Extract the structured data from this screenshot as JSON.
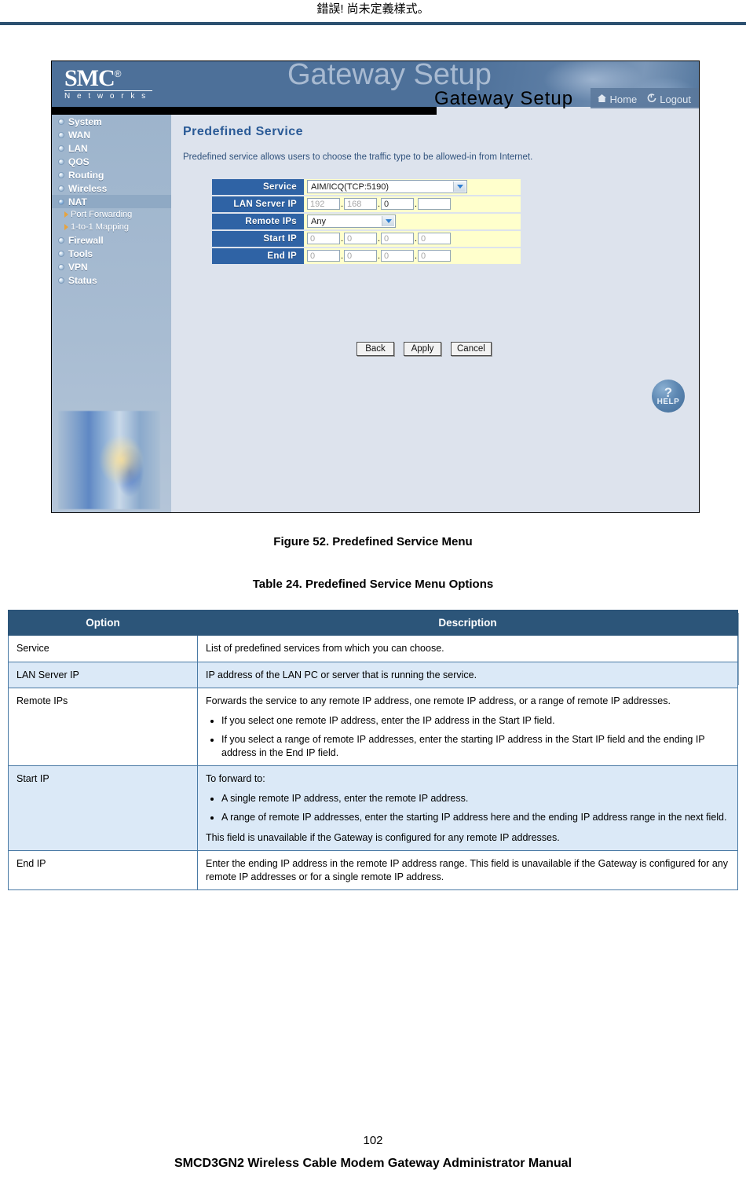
{
  "document": {
    "header_note": "錯誤! 尚未定義樣式。",
    "figure_caption": "Figure 52. Predefined Service Menu",
    "table_caption": "Table 24. Predefined Service Menu Options",
    "footer_page_number": "102",
    "footer_title": "SMCD3GN2 Wireless Cable Modem Gateway Administrator Manual"
  },
  "router_ui": {
    "logo": {
      "brand": "SMC",
      "registered_mark": "®",
      "tagline": "N e t w o r k s"
    },
    "banner": {
      "watermark": "Gateway Setup",
      "title": "Gateway Setup",
      "home_label": "Home",
      "logout_label": "Logout"
    },
    "sidebar": {
      "items": [
        {
          "label": "System",
          "active": false
        },
        {
          "label": "WAN",
          "active": false
        },
        {
          "label": "LAN",
          "active": false
        },
        {
          "label": "QOS",
          "active": false
        },
        {
          "label": "Routing",
          "active": false
        },
        {
          "label": "Wireless",
          "active": false
        },
        {
          "label": "NAT",
          "active": true
        },
        {
          "label": "Firewall",
          "active": false
        },
        {
          "label": "Tools",
          "active": false
        },
        {
          "label": "VPN",
          "active": false
        },
        {
          "label": "Status",
          "active": false
        }
      ],
      "submenu": [
        {
          "label": "Port Forwarding"
        },
        {
          "label": "1-to-1 Mapping"
        }
      ]
    },
    "page": {
      "title": "Predefined Service",
      "description": "Predefined service allows users to choose the traffic type to be allowed-in from Internet.",
      "fields": {
        "service": {
          "label": "Service",
          "value": "AIM/ICQ(TCP:5190)"
        },
        "lan_server_ip": {
          "label": "LAN Server IP",
          "octets": [
            "192",
            "168",
            "0",
            ""
          ]
        },
        "remote_ips": {
          "label": "Remote IPs",
          "value": "Any"
        },
        "start_ip": {
          "label": "Start IP",
          "octets": [
            "0",
            "0",
            "0",
            "0"
          ]
        },
        "end_ip": {
          "label": "End IP",
          "octets": [
            "0",
            "0",
            "0",
            "0"
          ]
        }
      },
      "buttons": {
        "back": "Back",
        "apply": "Apply",
        "cancel": "Cancel"
      },
      "help": {
        "mark": "?",
        "label": "HELP"
      }
    }
  },
  "options_table": {
    "headers": {
      "option": "Option",
      "description": "Description"
    },
    "rows": [
      {
        "option": "Service",
        "intro": "List of predefined services from which you can choose.",
        "bullets": [],
        "outro": ""
      },
      {
        "option": "LAN Server IP",
        "intro": "IP address of the LAN PC or server that is running the service.",
        "bullets": [],
        "outro": ""
      },
      {
        "option": "Remote IPs",
        "intro": "Forwards the service to any remote IP address, one remote IP address, or a range of remote IP addresses.",
        "bullets": [
          "If you select one remote IP address, enter the IP address in the Start IP field.",
          "If you select a range of remote IP addresses, enter the starting IP address in the Start IP field and the ending IP address in the End IP field."
        ],
        "outro": ""
      },
      {
        "option": "Start IP",
        "intro": "To forward to:",
        "bullets": [
          "A single remote IP address, enter the remote IP address.",
          "A range of remote IP addresses, enter the starting IP address here and the ending IP address range in the next field."
        ],
        "outro": "This field is unavailable if the Gateway is configured for any remote IP addresses."
      },
      {
        "option": "End IP",
        "intro": "Enter the ending IP address in the remote IP address range. This field is unavailable if the Gateway is configured for any remote IP addresses or for a single remote IP address.",
        "bullets": [],
        "outro": ""
      }
    ]
  },
  "colors": {
    "rule": "#2c5070",
    "banner_blue": "#4d7099",
    "label_blue": "#2f63a5",
    "field_yellow": "#ffffcc",
    "table_header": "#2c5579",
    "table_alt_row": "#dbe9f7",
    "title_blue": "#2a5a96"
  }
}
